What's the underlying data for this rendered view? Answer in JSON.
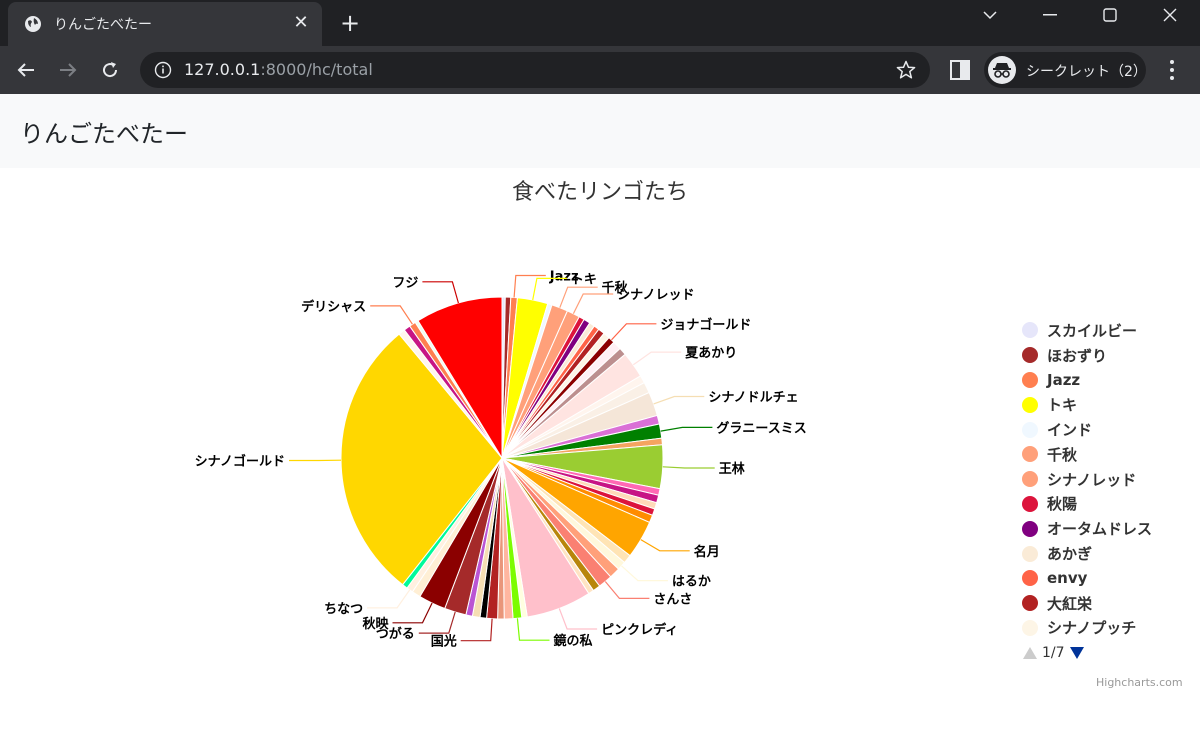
{
  "browser": {
    "tab_title": "りんごたべたー",
    "tab_close": "✕",
    "new_tab": "+",
    "url_host": "127.0.0.1",
    "url_rest": ":8000/hc/total",
    "incognito_label": "シークレット（2）"
  },
  "page": {
    "app_title": "りんごたべたー"
  },
  "chart_data": {
    "type": "pie",
    "title": "食べたリンゴたち",
    "slices": [
      {
        "name": "スカイルビー",
        "value": 0.3,
        "color": "#e6e6fa"
      },
      {
        "name": "ほおずり",
        "value": 0.5,
        "color": "#a52a2a"
      },
      {
        "name": "Jazz",
        "value": 0.6,
        "color": "#ff7f50"
      },
      {
        "name": "トキ",
        "value": 2.8,
        "color": "#ffff00"
      },
      {
        "name": "インド",
        "value": 0.4,
        "color": "#f0f8ff"
      },
      {
        "name": "千秋",
        "value": 1.5,
        "color": "#ffa07a"
      },
      {
        "name": "シナノレッド",
        "value": 1.2,
        "color": "#ffa07a"
      },
      {
        "name": "秋陽",
        "value": 0.5,
        "color": "#dc143c"
      },
      {
        "name": "オータムドレス",
        "value": 0.6,
        "color": "#800080"
      },
      {
        "name": "あかぎ",
        "value": 0.5,
        "color": "#faebd7"
      },
      {
        "name": "envy",
        "value": 0.5,
        "color": "#ff6347"
      },
      {
        "name": "大紅栄",
        "value": 0.6,
        "color": "#b22222"
      },
      {
        "name": "シナノプッチ",
        "value": 0.6,
        "color": "#fdf5e6"
      },
      {
        "name": "ジョナゴールド",
        "value": 0.6,
        "color": "#8b0000"
      },
      {
        "name": "",
        "value": 0.8,
        "color": "#fff0f5"
      },
      {
        "name": "",
        "value": 0.7,
        "color": "#bc8f8f"
      },
      {
        "name": "夏あかり",
        "value": 2.4,
        "color": "#ffe4e1"
      },
      {
        "name": "",
        "value": 0.7,
        "color": "#fff5ee"
      },
      {
        "name": "",
        "value": 1.0,
        "color": "#faf0e6"
      },
      {
        "name": "シナノドルチェ",
        "value": 2.2,
        "color": "#f5e6d8"
      },
      {
        "name": "",
        "value": 0.8,
        "color": "#da70d6"
      },
      {
        "name": "グラニースミス",
        "value": 1.3,
        "color": "#008000"
      },
      {
        "name": "",
        "value": 0.6,
        "color": "#f4a460"
      },
      {
        "name": "王林",
        "value": 4.0,
        "color": "#9acd32"
      },
      {
        "name": "",
        "value": 0.6,
        "color": "#ff69b4"
      },
      {
        "name": "",
        "value": 0.7,
        "color": "#c71585"
      },
      {
        "name": "",
        "value": 0.6,
        "color": "#ffdab9"
      },
      {
        "name": "",
        "value": 0.6,
        "color": "#dc143c"
      },
      {
        "name": "",
        "value": 0.7,
        "color": "#ff8c00"
      },
      {
        "name": "名月",
        "value": 3.5,
        "color": "#ffa500"
      },
      {
        "name": "",
        "value": 0.8,
        "color": "#ffe4b5"
      },
      {
        "name": "はるか",
        "value": 0.8,
        "color": "#fff8dc"
      },
      {
        "name": "",
        "value": 1.0,
        "color": "#ffa07a"
      },
      {
        "name": "さんさ",
        "value": 1.3,
        "color": "#fa8072"
      },
      {
        "name": "",
        "value": 0.7,
        "color": "#b8860b"
      },
      {
        "name": "",
        "value": 0.5,
        "color": "#ffe4c4"
      },
      {
        "name": "ピンクレディ",
        "value": 6.0,
        "color": "#ffc0cb"
      },
      {
        "name": "",
        "value": 0.5,
        "color": "#ffffe0"
      },
      {
        "name": "鏡の私",
        "value": 0.8,
        "color": "#7cfc00"
      },
      {
        "name": "",
        "value": 0.8,
        "color": "#ffb6a0"
      },
      {
        "name": "",
        "value": 0.6,
        "color": "#e9967a"
      },
      {
        "name": "国光",
        "value": 1.0,
        "color": "#b22222"
      },
      {
        "name": "",
        "value": 0.6,
        "color": "#000000"
      },
      {
        "name": "",
        "value": 0.7,
        "color": "#f5deb3"
      },
      {
        "name": "",
        "value": 0.6,
        "color": "#ba55d3"
      },
      {
        "name": "つがる",
        "value": 2.0,
        "color": "#a52a2a"
      },
      {
        "name": "秋映",
        "value": 2.5,
        "color": "#8b0000"
      },
      {
        "name": "",
        "value": 0.8,
        "color": "#ffefd5"
      },
      {
        "name": "ちなつ",
        "value": 0.6,
        "color": "#fff0e0"
      },
      {
        "name": "",
        "value": 0.5,
        "color": "#00fa9a"
      },
      {
        "name": "シナノゴールド",
        "value": 26.0,
        "color": "#ffd700"
      },
      {
        "name": "",
        "value": 0.6,
        "color": "#fff5ee"
      },
      {
        "name": "",
        "value": 0.6,
        "color": "#c71585"
      },
      {
        "name": "デリシャス",
        "value": 0.6,
        "color": "#ff7f50"
      },
      {
        "name": "",
        "value": 0.3,
        "color": "#f0fff0"
      },
      {
        "name": "フジ",
        "value": 8.0,
        "color": "#ff0000"
      }
    ],
    "data_labels": [
      {
        "name": "フジ",
        "color": "#cc0000"
      },
      {
        "name": "Jazz",
        "color": "#ff7f50"
      },
      {
        "name": "トキ",
        "color": "#ffff00"
      },
      {
        "name": "千秋",
        "color": "#ffa07a"
      },
      {
        "name": "シナノレッド",
        "color": "#ffa07a"
      },
      {
        "name": "ジョナゴールド",
        "color": "#ff6347"
      },
      {
        "name": "夏あかり",
        "color": "#ffe4e1"
      },
      {
        "name": "シナノドルチェ",
        "color": "#f5deb3"
      },
      {
        "name": "グラニースミス",
        "color": "#008000"
      },
      {
        "name": "王林",
        "color": "#9acd32"
      },
      {
        "name": "名月",
        "color": "#ffa500"
      },
      {
        "name": "はるか",
        "color": "#fff8dc"
      },
      {
        "name": "さんさ",
        "color": "#fa8072"
      },
      {
        "name": "ピンクレディ",
        "color": "#ffc0cb"
      },
      {
        "name": "鏡の私",
        "color": "#7cfc00"
      },
      {
        "name": "国光",
        "color": "#b22222"
      },
      {
        "name": "つがる",
        "color": "#a52a2a"
      },
      {
        "name": "秋映",
        "color": "#8b0000"
      },
      {
        "name": "ちなつ",
        "color": "#fff0e0"
      },
      {
        "name": "シナノゴールド",
        "color": "#ffd700"
      },
      {
        "name": "デリシャス",
        "color": "#ff7f50"
      }
    ],
    "legend": {
      "placement": "right",
      "items": [
        {
          "name": "スカイルビー",
          "color": "#e6e6fa"
        },
        {
          "name": "ほおずり",
          "color": "#a52a2a"
        },
        {
          "name": "Jazz",
          "color": "#ff7f50"
        },
        {
          "name": "トキ",
          "color": "#ffff00"
        },
        {
          "name": "インド",
          "color": "#f0f8ff"
        },
        {
          "name": "千秋",
          "color": "#ffa07a"
        },
        {
          "name": "シナノレッド",
          "color": "#ffa07a"
        },
        {
          "name": "秋陽",
          "color": "#dc143c"
        },
        {
          "name": "オータムドレス",
          "color": "#800080"
        },
        {
          "name": "あかぎ",
          "color": "#faebd7"
        },
        {
          "name": "envy",
          "color": "#ff6347"
        },
        {
          "name": "大紅栄",
          "color": "#b22222"
        },
        {
          "name": "シナノプッチ",
          "color": "#fdf5e6"
        }
      ],
      "page_text": "1/7",
      "prev_icon": "triangle-up-icon",
      "next_icon": "triangle-down-icon"
    },
    "credits": "Highcharts.com"
  }
}
